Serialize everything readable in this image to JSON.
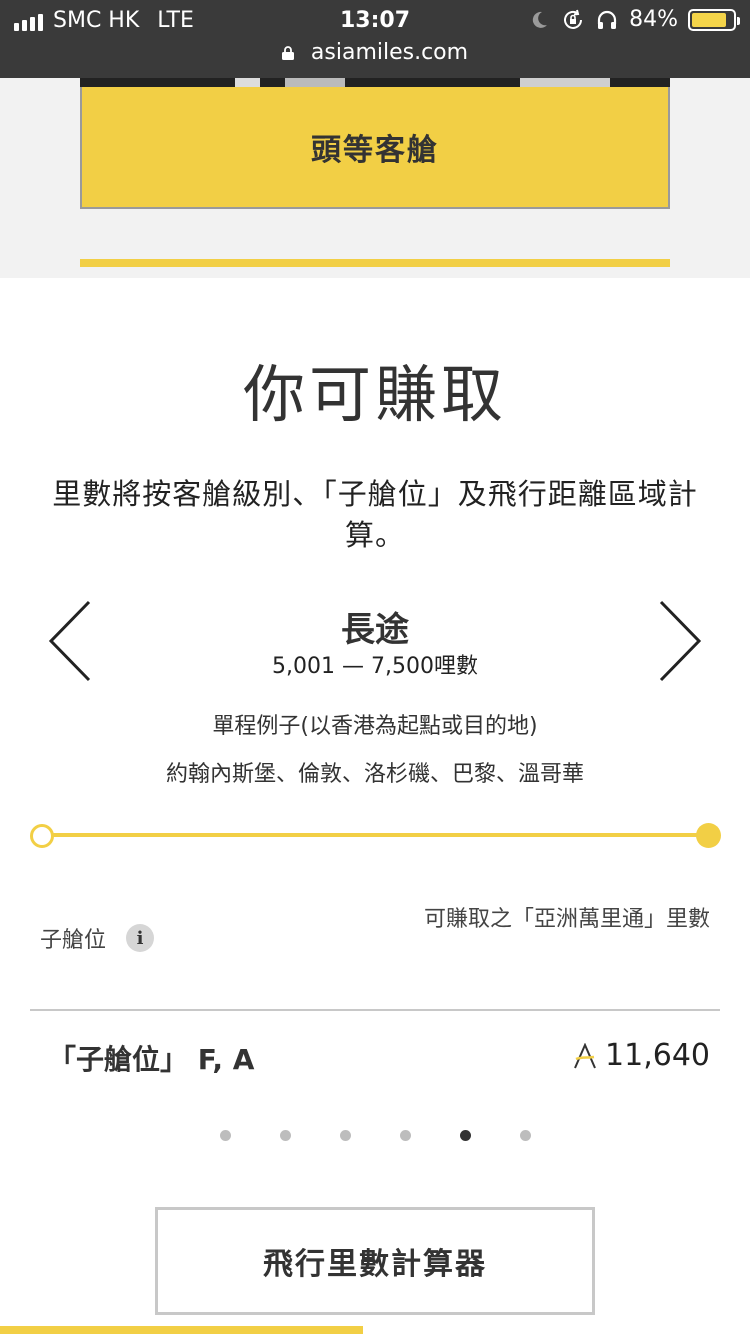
{
  "status_bar": {
    "carrier": "SMC HK",
    "network": "LTE",
    "time": "13:07",
    "battery": "84%",
    "battery_level": 0.84
  },
  "browser": {
    "url": "asiamiles.com"
  },
  "cabin_card": {
    "label": "頭等客艙"
  },
  "section": {
    "heading": "你可賺取",
    "description": "里數將按客艙級別、「子艙位」及飛行距離區域計算。"
  },
  "region": {
    "title": "長途",
    "range": "5,001 — 7,500哩數",
    "example_label": "單程例子(以香港為起點或目的地)",
    "example_cities": "約翰內斯堡、倫敦、洛杉磯、巴黎、溫哥華"
  },
  "table": {
    "col_subclass": "子艙位",
    "col_miles": "可賺取之「亞洲萬里通」里數",
    "row": {
      "fare_class": "「子艙位」 F, A",
      "miles": "11,640"
    }
  },
  "pagination": {
    "total": 6,
    "active": 5
  },
  "calc_button": {
    "label": "飛行里數計算器"
  },
  "colors": {
    "accent_yellow": "#f2cf45",
    "status_bar": "#3a3a3a",
    "text_dark": "#333333"
  },
  "icons": [
    "lock-icon",
    "chevron-left-icon",
    "chevron-right-icon",
    "info-icon",
    "asia-miles-icon",
    "moon-icon",
    "rotation-lock-icon",
    "headphones-icon",
    "battery-icon",
    "signal-icon"
  ]
}
